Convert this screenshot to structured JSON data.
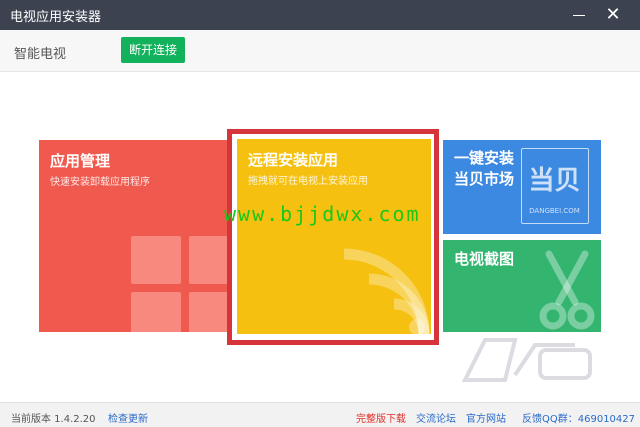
{
  "window": {
    "title": "电视应用安装器",
    "minimize_icon": "minimize-icon",
    "close_glyph": "✕"
  },
  "device": {
    "name": "智能电视",
    "disconnect_label": "断开连接"
  },
  "tiles": {
    "apps": {
      "title": "应用管理",
      "subtitle": "快速安装卸载应用程序",
      "color": "#f0594e"
    },
    "remote": {
      "title": "远程安装应用",
      "subtitle": "拖拽就可在电视上安装应用",
      "color": "#f5c00f",
      "highlight_border": "#d5353a"
    },
    "oneclick": {
      "title_line1": "一键安装",
      "title_line2": "当贝市场",
      "logo_cn": "当贝",
      "logo_en": "DANGBEI.COM",
      "color": "#3c89e2"
    },
    "tvshot": {
      "title": "电视截图",
      "color": "#33b46f"
    }
  },
  "watermark": {
    "text": "www.bjjdwx.com",
    "color": "#18c91a"
  },
  "footer": {
    "version": "当前版本 1.4.2.20",
    "check_update": "检查更新",
    "full_download": "完整版下载",
    "forum": "交流论坛",
    "website": "官方网站",
    "feedback_qq": "反馈QQ群：469010427"
  }
}
